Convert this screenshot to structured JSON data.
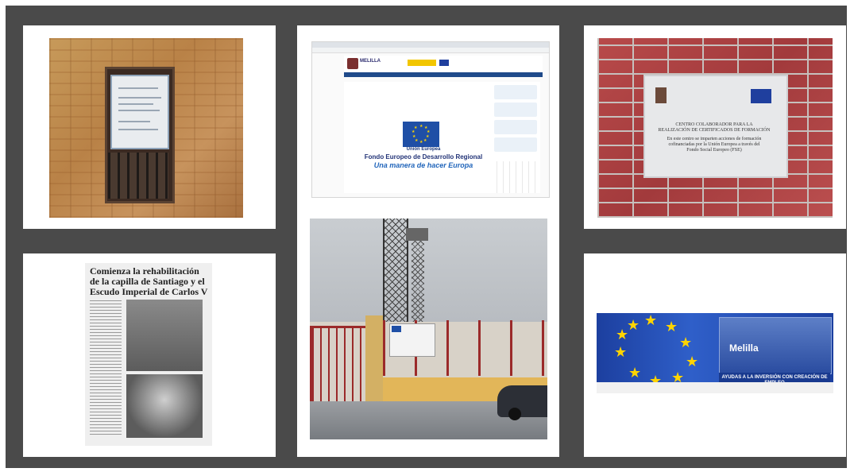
{
  "panels": {
    "wall_window_photo": {},
    "website_screenshot": {
      "site_name": "MELILLA",
      "eu_label": "Unión Europea",
      "fund_name": "Fondo Europeo de Desarrollo Regional",
      "motto": "Una manera de hacer Europa"
    },
    "stadium_photo": {},
    "brick_plaque_photo": {
      "plaque_text": [
        "CENTRO COLABORADOR PARA LA",
        "REALIZACIÓN DE CERTIFICADOS DE FORMACIÓN",
        "En este centro se imparten acciones de formación",
        "cofinanciadas por la Unión Europea a través del",
        "Fondo Social Europeo (FSE)"
      ]
    },
    "newspaper_clipping": {
      "headline": "Comienza la rehabilitación de la capilla de Santiago y el Escudo Imperial de Carlos V"
    },
    "eu_banner": {
      "city_word": "Melilla",
      "caption": "AYUDAS A LA INVERSIÓN CON CREACIÓN DE EMPLEO"
    }
  },
  "colors": {
    "background": "#4a4a4a",
    "card": "#ffffff",
    "eu_blue": "#1f3f9e",
    "eu_star": "#ffd400"
  }
}
